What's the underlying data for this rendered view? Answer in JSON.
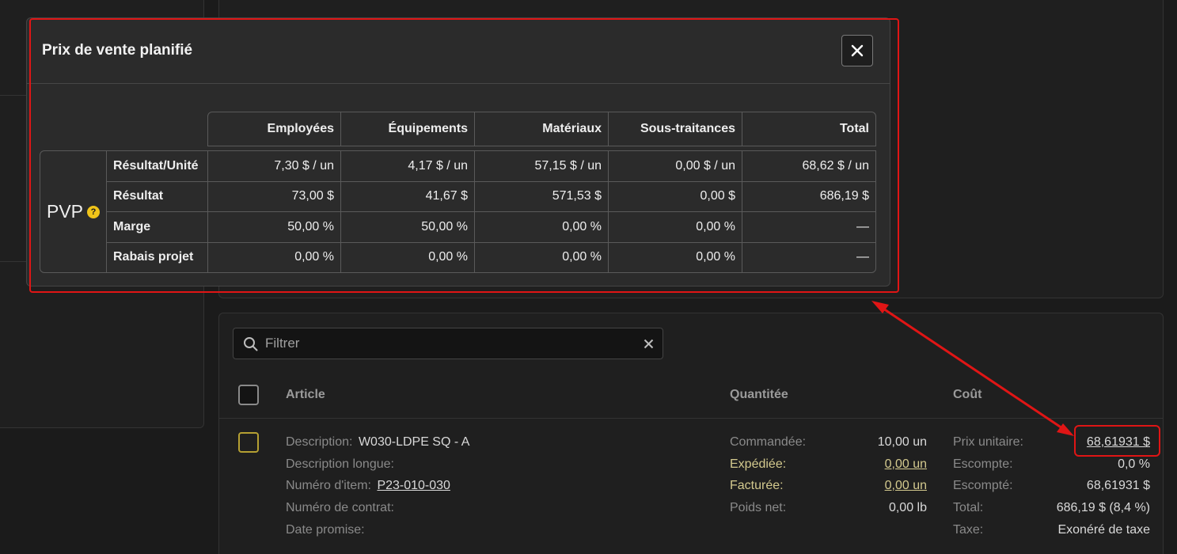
{
  "modal": {
    "title": "Prix de vente planifié",
    "close_label": "×",
    "pvp_label": "PVP",
    "help_symbol": "?",
    "columns": [
      "Employées",
      "Équipements",
      "Matériaux",
      "Sous-traitances",
      "Total"
    ],
    "rows": [
      {
        "label": "Résultat/Unité",
        "values": [
          "7,30 $ / un",
          "4,17 $ / un",
          "57,15 $ / un",
          "0,00 $ / un",
          "68,62 $ / un"
        ]
      },
      {
        "label": "Résultat",
        "values": [
          "73,00 $",
          "41,67 $",
          "571,53 $",
          "0,00 $",
          "686,19 $"
        ]
      },
      {
        "label": "Marge",
        "values": [
          "50,00 %",
          "50,00 %",
          "0,00 %",
          "0,00 %",
          "—"
        ]
      },
      {
        "label": "Rabais projet",
        "values": [
          "0,00 %",
          "0,00 %",
          "0,00 %",
          "0,00 %",
          "—"
        ]
      }
    ]
  },
  "filter": {
    "placeholder": "Filtrer"
  },
  "table": {
    "headers": {
      "article": "Article",
      "quantity": "Quantitée",
      "cost": "Coût"
    }
  },
  "item": {
    "article": {
      "description_label": "Description:",
      "description_value": "W030-LDPE SQ - A",
      "long_description_label": "Description longue:",
      "item_number_label": "Numéro d'item:",
      "item_number_value": "P23-010-030",
      "contract_label": "Numéro de contrat:",
      "promised_date_label": "Date promise:"
    },
    "quantity": {
      "ordered_label": "Commandée:",
      "ordered_value": "10,00 un",
      "shipped_label": "Expédiée:",
      "shipped_value": "0,00 un",
      "billed_label": "Facturée:",
      "billed_value": "0,00 un",
      "net_weight_label": "Poids net:",
      "net_weight_value": "0,00 lb"
    },
    "cost": {
      "unit_price_label": "Prix unitaire:",
      "unit_price_value": "68,61931 $",
      "discount_label": "Escompte:",
      "discount_value": "0,0 %",
      "discounted_label": "Escompté:",
      "discounted_value": "68,61931 $",
      "total_label": "Total:",
      "total_value": "686,19 $ (8,4 %)",
      "tax_label": "Taxe:",
      "tax_value": "Exonéré de taxe"
    }
  },
  "colors": {
    "background": "#1b1b1b",
    "modal": "#2b2b2b",
    "annotation_red": "#e01515",
    "help_yellow": "#f0c419",
    "checkbox_yellow": "#b5a032"
  }
}
